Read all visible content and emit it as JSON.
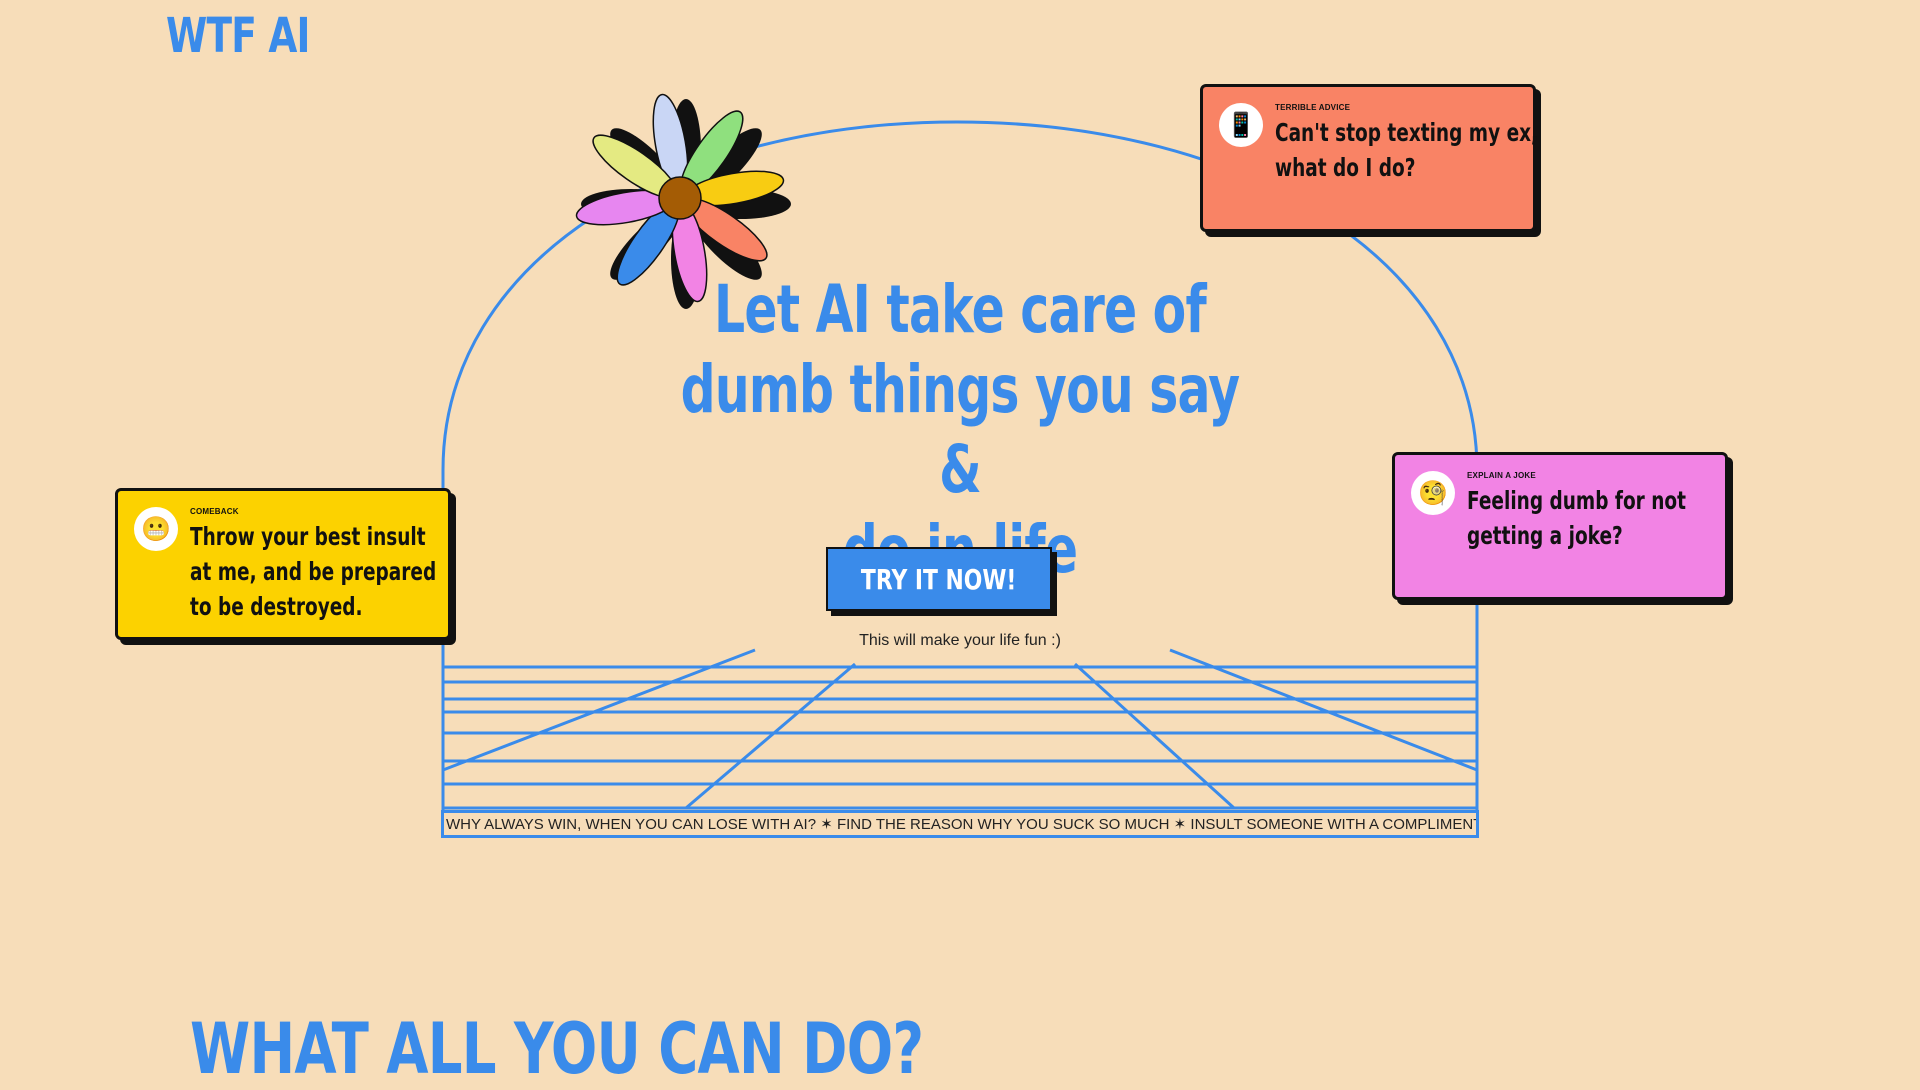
{
  "header": {
    "brand": "WTF AI"
  },
  "hero": {
    "headline_lines": [
      "Let AI take care of",
      "dumb things you say &",
      "do in life"
    ],
    "cta_label": "TRY IT NOW!",
    "subtext": "This will make your life fun :)"
  },
  "ticker": {
    "text": "WHY ALWAYS WIN, WHEN YOU CAN LOSE WITH AI? ✶ FIND THE REASON WHY YOU SUCK SO MUCH ✶ INSULT SOMEONE WITH A COMPLIMENT ✶"
  },
  "cards": {
    "comeback": {
      "tag": "COMEBACK",
      "emoji": "😬",
      "lines": [
        "Throw your best insult",
        "at me, and be prepared",
        "to be destroyed."
      ]
    },
    "advice": {
      "tag": "TERRIBLE ADVICE",
      "emoji": "📱",
      "lines": [
        "Can't stop texting my ex,",
        "what do I do?"
      ]
    },
    "joke": {
      "tag": "EXPLAIN A JOKE",
      "emoji": "🧐",
      "lines": [
        "Feeling dumb for not",
        "getting a joke?"
      ]
    }
  },
  "section": {
    "title": "WHAT ALL YOU CAN DO?"
  },
  "colors": {
    "background": "#f7ddb9",
    "accent_blue": "#3a8bea",
    "card_yellow": "#fcd200",
    "card_salmon": "#f98365",
    "card_pink": "#f283e4"
  },
  "icons": {
    "decor": "flower-icon"
  }
}
